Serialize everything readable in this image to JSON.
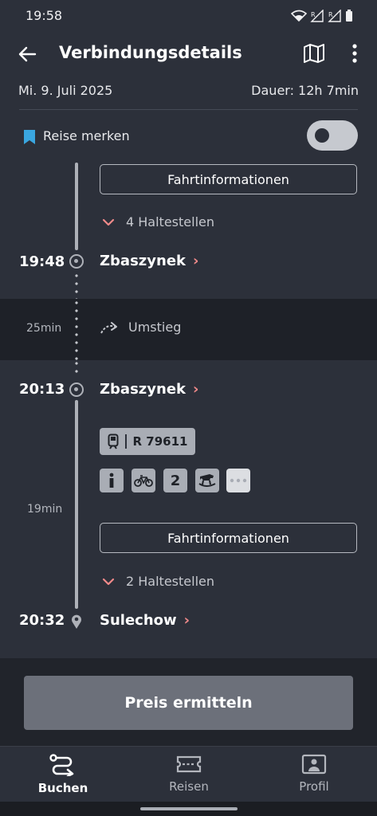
{
  "status_bar": {
    "time": "19:58"
  },
  "header": {
    "title": "Verbindungsdetails"
  },
  "trip": {
    "date": "Mi. 9. Juli 2025",
    "duration": "Dauer: 12h 7min"
  },
  "save": {
    "label": "Reise merken",
    "enabled": false
  },
  "segment_prev": {
    "info_button": "Fahrtinformationen",
    "stops_label": "4 Haltestellen",
    "arrival": {
      "time": "19:48",
      "station": "Zbaszynek"
    }
  },
  "transfer": {
    "duration": "25min",
    "label": "Umstieg"
  },
  "segment_next": {
    "departure": {
      "time": "20:13",
      "station": "Zbaszynek"
    },
    "train": "R 79611",
    "amenities": [
      "info-icon",
      "bicycle-icon",
      "second-class-icon",
      "rocking-horse-icon",
      "more-icon"
    ],
    "second_class": "2",
    "duration": "19min",
    "info_button": "Fahrtinformationen",
    "stops_label": "2 Haltestellen",
    "arrival": {
      "time": "20:32",
      "station": "Sulechow"
    }
  },
  "footer": {
    "price_button": "Preis ermitteln"
  },
  "nav": {
    "items": [
      {
        "label": "Buchen",
        "icon": "route-icon",
        "active": true
      },
      {
        "label": "Reisen",
        "icon": "ticket-icon",
        "active": false
      },
      {
        "label": "Profil",
        "icon": "profile-icon",
        "active": false
      }
    ]
  },
  "colors": {
    "background": "#2c303a",
    "accent_chevron": "#f08a8a",
    "bookmark": "#3aa6e0",
    "badge": "#a9adb5"
  }
}
